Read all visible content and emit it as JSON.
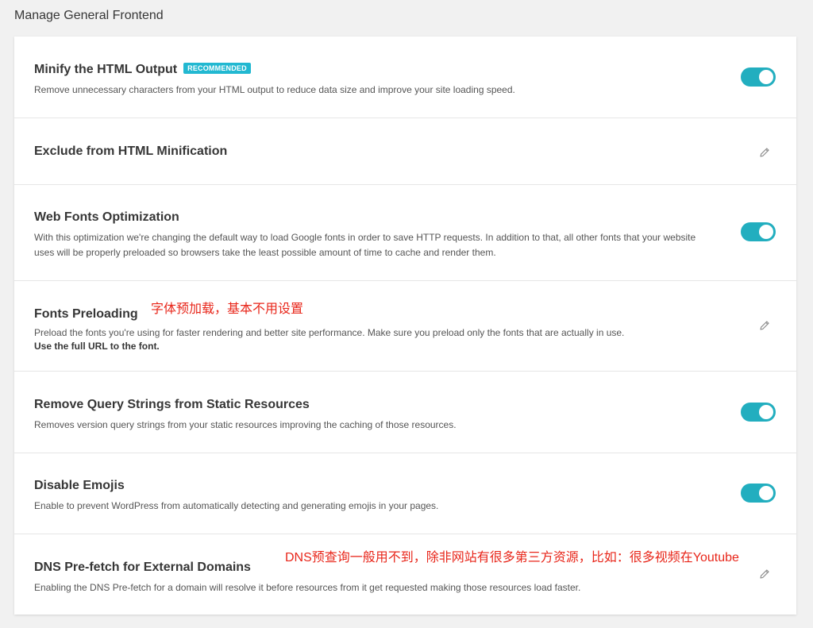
{
  "page": {
    "section_title": "Manage General Frontend"
  },
  "settings": [
    {
      "title": "Minify the HTML Output",
      "badge": "RECOMMENDED",
      "description": "Remove unnecessary characters from your HTML output to reduce data size and improve your site loading speed.",
      "control": "toggle",
      "enabled": true
    },
    {
      "title": "Exclude from HTML Minification",
      "control": "edit"
    },
    {
      "title": "Web Fonts Optimization",
      "description": "With this optimization we're changing the default way to load Google fonts in order to save HTTP requests. In addition to that, all other fonts that your website uses will be properly preloaded so browsers take the least possible amount of time to cache and render them.",
      "control": "toggle",
      "enabled": true
    },
    {
      "title": "Fonts Preloading",
      "description": "Preload the fonts you're using for faster rendering and better site performance. Make sure you preload only the fonts that are actually in use.",
      "description_strong": "Use the full URL to the font.",
      "control": "edit"
    },
    {
      "title": "Remove Query Strings from Static Resources",
      "description": "Removes version query strings from your static resources improving the caching of those resources.",
      "control": "toggle",
      "enabled": true
    },
    {
      "title": "Disable Emojis",
      "description": "Enable to prevent WordPress from automatically detecting and generating emojis in your pages.",
      "control": "toggle",
      "enabled": true
    },
    {
      "title": "DNS Pre-fetch for External Domains",
      "description": "Enabling the DNS Pre-fetch for a domain will resolve it before resources from it get requested making those resources load faster.",
      "control": "edit"
    }
  ],
  "annotations": {
    "fonts_preloading_note": "字体预加载，基本不用设置",
    "dns_prefetch_note": "DNS预查询一般用不到，除非网站有很多第三方资源，比如：很多视频在Youtube"
  },
  "colors": {
    "toggle_on": "#22aebf",
    "badge": "#22b8d1",
    "annotation": "#e8261a",
    "background": "#f1f1f1"
  },
  "icons": {
    "edit": "pencil-icon"
  }
}
